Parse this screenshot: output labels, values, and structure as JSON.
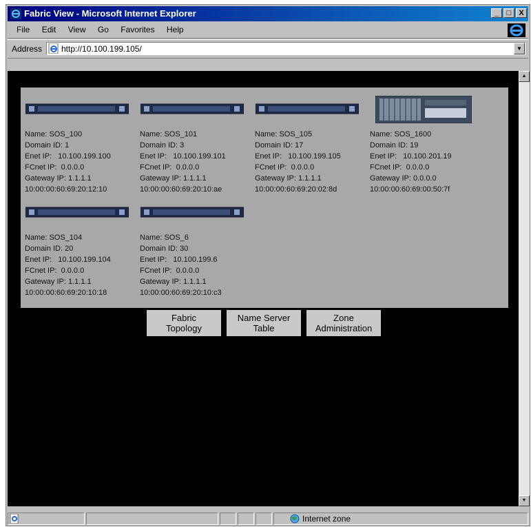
{
  "window": {
    "title": "Fabric View - Microsoft Internet Explorer",
    "min": "_",
    "max": "□",
    "close": "X"
  },
  "menu": [
    "File",
    "Edit",
    "View",
    "Go",
    "Favorites",
    "Help"
  ],
  "address": {
    "label": "Address",
    "url": "http://10.100.199.105/"
  },
  "switches": [
    {
      "name": "Name: SOS_100",
      "domain": "Domain ID: 1",
      "enet": "Enet IP:   10.100.199.100",
      "fcnet": "FCnet IP:  0.0.0.0",
      "gateway": "Gateway IP: 1.1.1.1",
      "wwn": "10:00:00:60:69:20:12:10"
    },
    {
      "name": "Name: SOS_101",
      "domain": "Domain ID: 3",
      "enet": "Enet IP:   10.100.199.101",
      "fcnet": "FCnet IP:  0.0.0.0",
      "gateway": "Gateway IP: 1.1.1.1",
      "wwn": "10:00:00:60:69:20:10:ae"
    },
    {
      "name": "Name: SOS_105",
      "domain": "Domain ID: 17",
      "enet": "Enet IP:   10.100.199.105",
      "fcnet": "FCnet IP:  0.0.0.0",
      "gateway": "Gateway IP: 1.1.1.1",
      "wwn": "10:00:00:60:69:20:02:8d"
    },
    {
      "name": "Name: SOS_1600",
      "domain": "Domain ID: 19",
      "enet": "Enet IP:   10.100.201.19",
      "fcnet": "FCnet IP:  0.0.0.0",
      "gateway": "Gateway IP: 0.0.0.0",
      "wwn": "10:00:00:60:69:00:50:7f"
    },
    {
      "name": "Name: SOS_104",
      "domain": "Domain ID: 20",
      "enet": "Enet IP:   10.100.199.104",
      "fcnet": "FCnet IP:  0.0.0.0",
      "gateway": "Gateway IP: 1.1.1.1",
      "wwn": "10:00:00:60:69:20:10:18"
    },
    {
      "name": "Name: SOS_6",
      "domain": "Domain ID: 30",
      "enet": "Enet IP:   10.100.199.6",
      "fcnet": "FCnet IP:  0.0.0.0",
      "gateway": "Gateway IP: 1.1.1.1",
      "wwn": "10:00:00:60:69:20:10:c3"
    }
  ],
  "buttons": {
    "fabric_topology": [
      "Fabric",
      "Topology"
    ],
    "name_server": [
      "Name Server",
      "Table"
    ],
    "zone_admin": [
      "Zone",
      "Administration"
    ]
  },
  "status": {
    "zone": "Internet zone"
  },
  "colors": {
    "title_start": "#000080",
    "title_end": "#1084d0",
    "page_bg": "#000000",
    "panel_bg": "#a8a8a8",
    "button_bg": "#c9c9c9"
  }
}
